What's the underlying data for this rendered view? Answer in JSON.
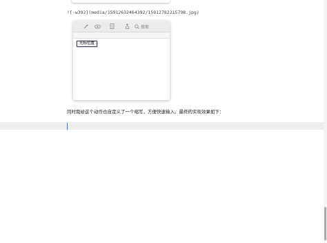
{
  "document": {
    "image_markdown": "![-w392](media/15912632464392/15912782215798.jpg)",
    "screenshot": {
      "toolbar_icons": [
        "magic-wand-icon",
        "eye-icon",
        "document-icon",
        "share-icon",
        "search-icon"
      ],
      "search_placeholder": "搜索",
      "cursor_tag_label": "光标位置"
    },
    "paragraph": "同时我给这个动作也自定义了一个缩写，方便快速输入。最终的实现效果如下："
  }
}
